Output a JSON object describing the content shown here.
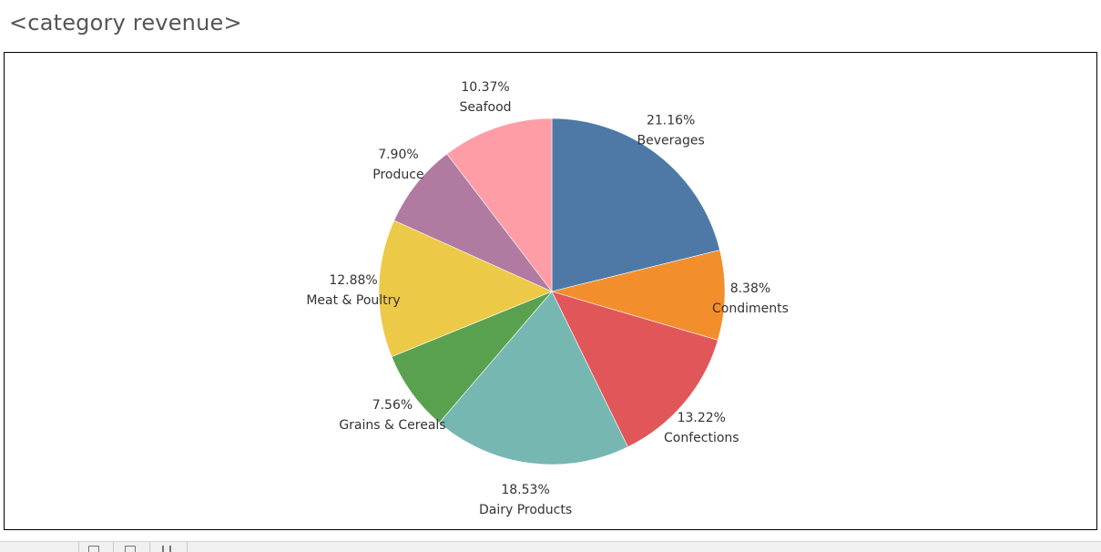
{
  "sheet": {
    "title": "<category revenue>"
  },
  "chart_data": {
    "type": "pie",
    "categories": [
      "Beverages",
      "Condiments",
      "Confections",
      "Dairy Products",
      "Grains & Cereals",
      "Meat & Poultry",
      "Produce",
      "Seafood"
    ],
    "values": [
      21.16,
      8.38,
      13.22,
      18.53,
      7.56,
      12.88,
      7.9,
      10.37
    ],
    "value_labels": [
      "21.16%",
      "8.38%",
      "13.22%",
      "18.53%",
      "7.56%",
      "12.88%",
      "7.90%",
      "10.37%"
    ],
    "colors": [
      "#4e79a7",
      "#f28e2b",
      "#e15759",
      "#76b7b2",
      "#59a14f",
      "#edc948",
      "#b07aa1",
      "#ff9da7"
    ],
    "start": "12 o'clock",
    "direction": "clockwise",
    "legend": "none",
    "title": ""
  },
  "status_bar": {
    "icons": [
      "new-sheet-icon",
      "new-dashboard-icon",
      "new-story-icon"
    ]
  }
}
